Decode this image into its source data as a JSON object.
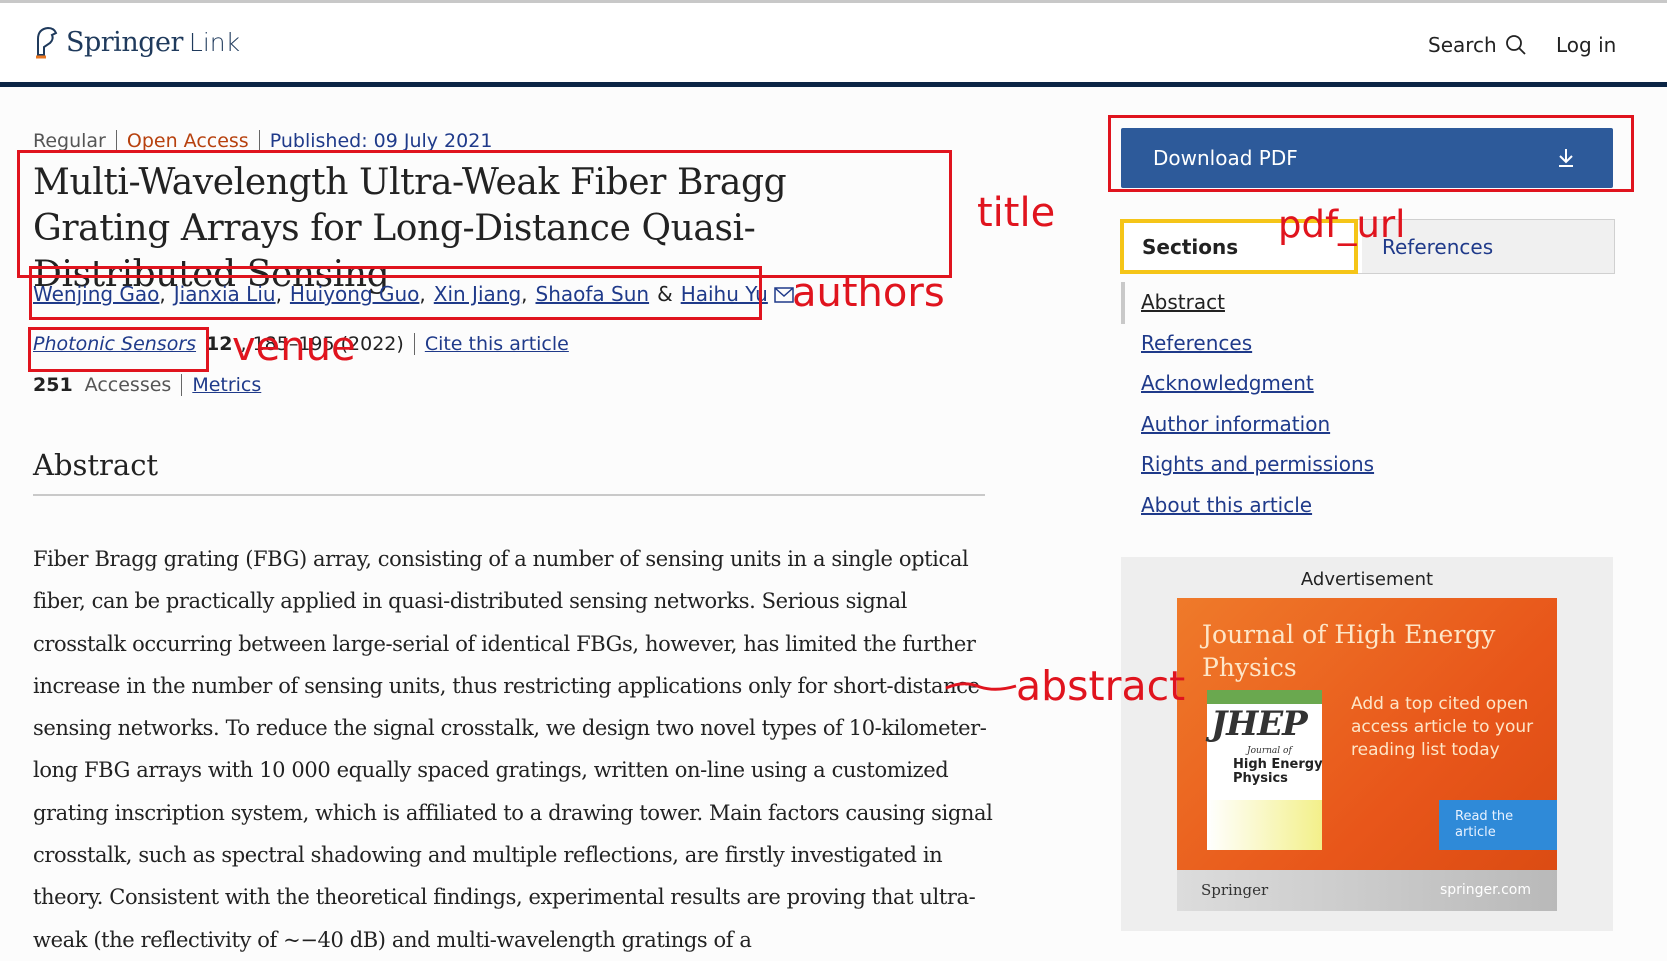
{
  "header": {
    "logo_springer": "Springer",
    "logo_link": "Link",
    "search_label": "Search",
    "login_label": "Log in"
  },
  "article": {
    "type": "Regular",
    "access": "Open Access",
    "published": "Published: 09 July 2021",
    "title": "Multi-Wavelength Ultra-Weak Fiber Bragg Grating Arrays for Long-Distance Quasi-Distributed Sensing",
    "authors": [
      "Wenjing Gao",
      "Jianxia Liu",
      "Huiyong Guo",
      "Xin Jiang",
      "Shaofa Sun",
      "Haihu Yu"
    ],
    "journal": "Photonic Sensors",
    "volume": "12",
    "pages_year": ", 185–195 (2022)",
    "cite_label": "Cite this article",
    "accesses_count": "251",
    "accesses_label": "Accesses",
    "metrics_label": "Metrics",
    "abstract_heading": "Abstract",
    "abstract_text": "Fiber Bragg grating (FBG) array, consisting of a number of sensing units in a single optical fiber, can be practically applied in quasi-distributed sensing networks. Serious signal crosstalk occurring between large-serial of identical FBGs, however, has limited the further increase in the number of sensing units, thus restricting applications only for short-distance sensing networks. To reduce the signal crosstalk, we design two novel types of 10-kilometer-long FBG arrays with 10 000 equally spaced gratings, written on-line using a customized grating inscription system, which is affiliated to a drawing tower. Main factors causing signal crosstalk, such as spectral shadowing and multiple reflections, are firstly investigated in theory. Consistent with the theoretical findings, experimental results are proving that ultra-weak (the reflectivity of ~−40 dB) and multi-wavelength gratings of a"
  },
  "sidebar": {
    "download_label": "Download PDF",
    "tabs": [
      "Sections",
      "References"
    ],
    "toc": [
      "Abstract",
      "References",
      "Acknowledgment",
      "Author information",
      "Rights and permissions",
      "About this article"
    ]
  },
  "ad": {
    "label": "Advertisement",
    "title": "Journal of High Energy Physics",
    "cover_abbrev": "JHEP",
    "cover_journal_of": "Journal of",
    "cover_name": "High Energy Physics",
    "body": "Add a top cited open access article to your reading list today",
    "cta": "Read the article",
    "brand": "Springer",
    "url": "springer.com"
  },
  "annotations": {
    "title": "title",
    "authors": "authors",
    "venue": "venue",
    "pdf_url": "pdf_url",
    "abstract": "abstract"
  },
  "colors": {
    "link": "#1f3a8a",
    "open_access": "#b7410e",
    "header_bar": "#0b2545",
    "download_button": "#2d5a9a",
    "annotation_red": "#e0141e",
    "annotation_yellow": "#f5c518"
  }
}
